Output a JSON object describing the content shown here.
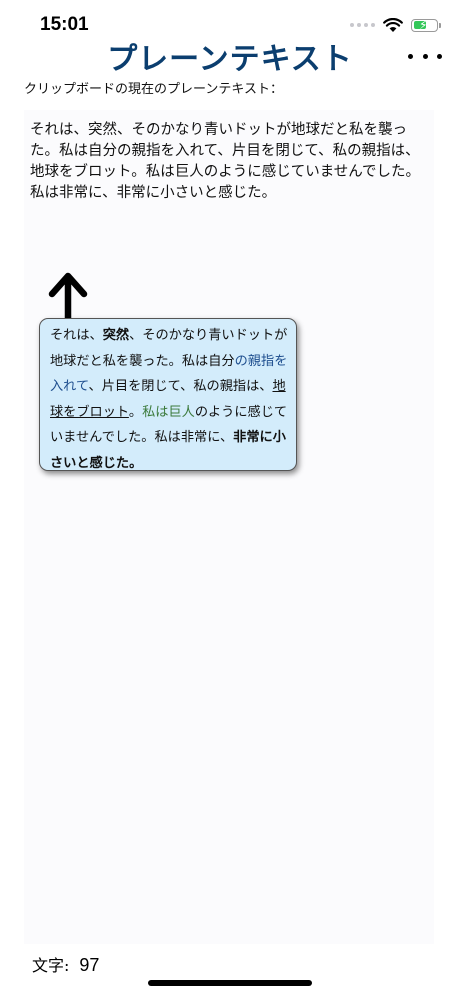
{
  "status_bar": {
    "time": "15:01",
    "icons": [
      "cellular-dots-icon",
      "wifi-icon",
      "battery-charging-icon"
    ],
    "battery_color": "#34c759"
  },
  "nav": {
    "title": "プレーンテキスト",
    "title_color": "#0b3e6f",
    "more_icon": "more-horizontal-icon"
  },
  "caption": "クリップボードの現在のプレーンテキスト：",
  "plain_text": "それは、突然、そのかなり青いドットが地球だと私を襲った。私は自分の親指を入れて、片目を閉じて、私の親指は、地球をブロット。私は巨人のように感じていませんでした。私は非常に、非常に小さいと感じた。",
  "styled_text": {
    "p01": "それは、",
    "p02": "突然",
    "p03": "、そのかなり青いドットが地球だと私を襲った。私は自分",
    "p04": "の親指を入れて",
    "p05": "、片目を閉じて、私の親指は、",
    "p06": "地球をブロット",
    "p07": "。",
    "p08": "私は巨人",
    "p09": "のように感じていませんでした。私は非常に、",
    "p10": "非常に小さいと感じた。",
    "box_color": "#d3ecfb",
    "blue_color": "#1f4f8f",
    "green_color": "#3b7a3b"
  },
  "arrow_icon": "arrow-up-icon",
  "char_count": {
    "label": "文字:",
    "value": "97"
  }
}
